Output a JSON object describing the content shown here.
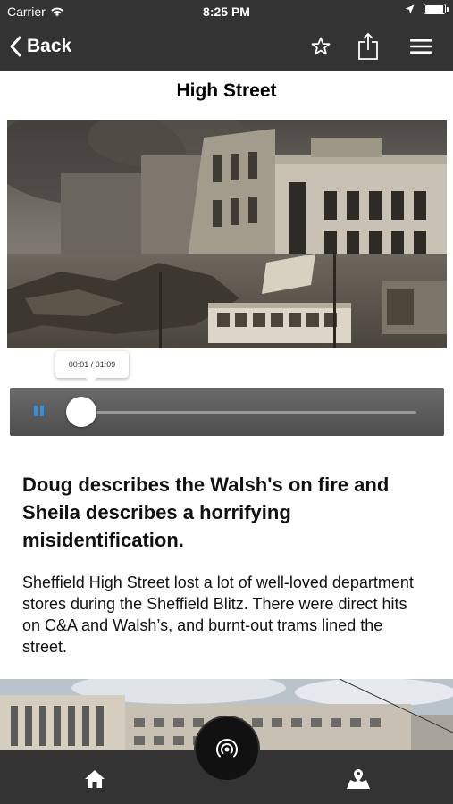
{
  "status_bar": {
    "carrier": "Carrier",
    "time": "8:25 PM",
    "battery_level": 0.95
  },
  "nav": {
    "back_label": "Back",
    "icons": [
      "star-icon",
      "share-icon",
      "menu-icon"
    ]
  },
  "page": {
    "title": "High Street"
  },
  "audio": {
    "time_display": "00:01 / 01:09",
    "progress": 0.0145,
    "state": "playing"
  },
  "article": {
    "headline": "Doug describes the Walsh's on fire and Sheila describes a horrifying misidentification.",
    "body": "Sheffield High Street lost a lot of well-loved department stores during the Sheffield Blitz. There were direct hits on C&A and Walsh’s, and burnt-out trams lined the street."
  },
  "tabbar": {
    "icons": [
      "home-icon",
      "broadcast-icon",
      "map-icon"
    ]
  },
  "colors": {
    "bar": "#333333",
    "accent": "#2f8fe0"
  }
}
